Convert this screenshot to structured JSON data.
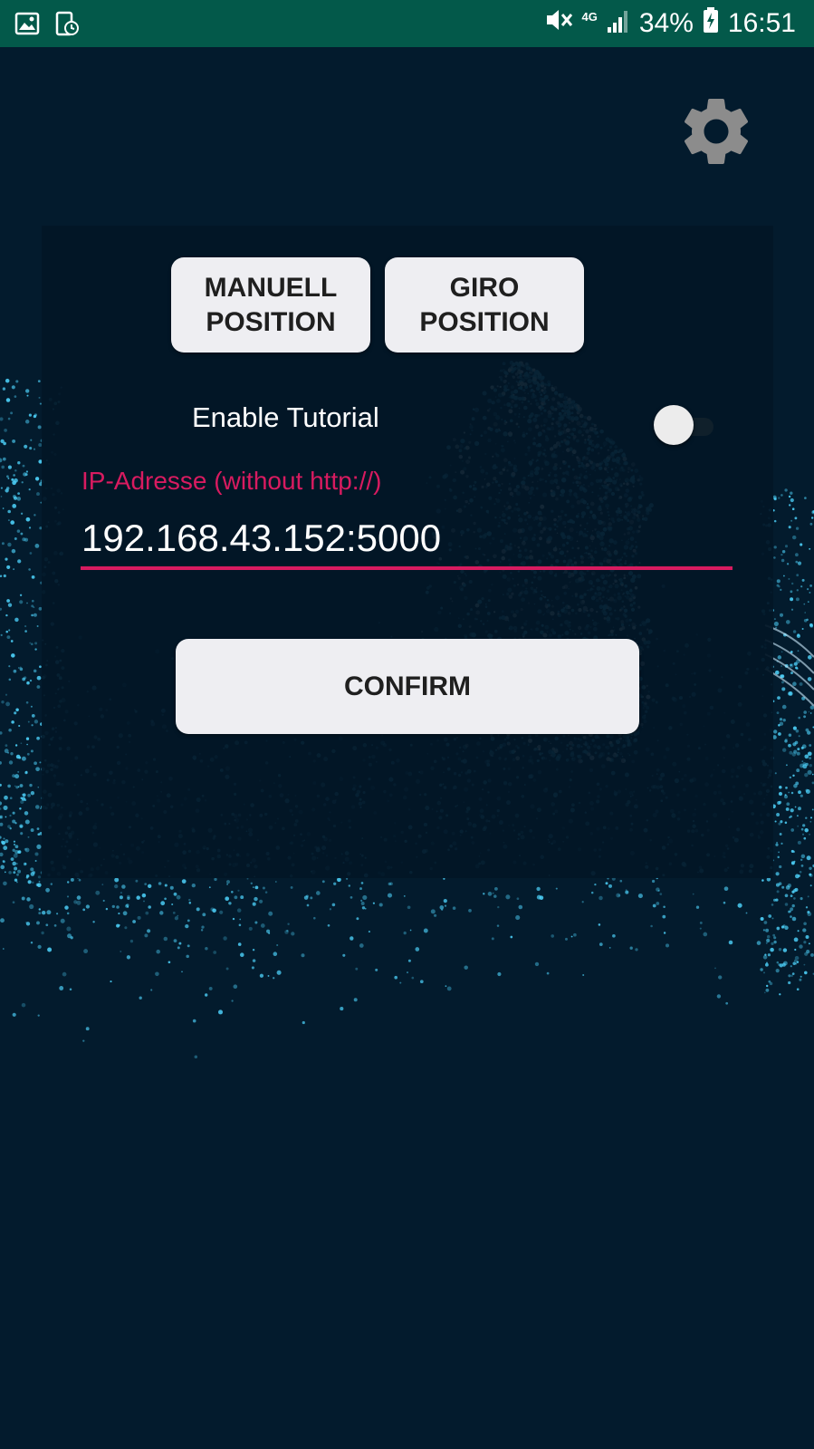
{
  "status_bar": {
    "network": "4G",
    "battery": "34%",
    "time": "16:51",
    "icons": [
      "gallery-icon",
      "screen-recorder-icon",
      "mute-icon",
      "signal-icon",
      "battery-charging-icon"
    ]
  },
  "toolbar": {
    "settings_icon": "gear-icon"
  },
  "buttons": {
    "manual_line1": "MANUELL",
    "manual_line2": "POSITION",
    "giro_line1": "GIRO",
    "giro_line2": "POSITION",
    "confirm": "CONFIRM"
  },
  "tutorial": {
    "label": "Enable Tutorial",
    "enabled": false
  },
  "ip": {
    "label": "IP-Adresse (without http://)",
    "value": "192.168.43.152:5000"
  },
  "colors": {
    "status_bar": "#03594a",
    "background": "#031b2d",
    "accent": "#d81b60",
    "button": "#eeeef2",
    "particles": "#4fd6ff"
  }
}
